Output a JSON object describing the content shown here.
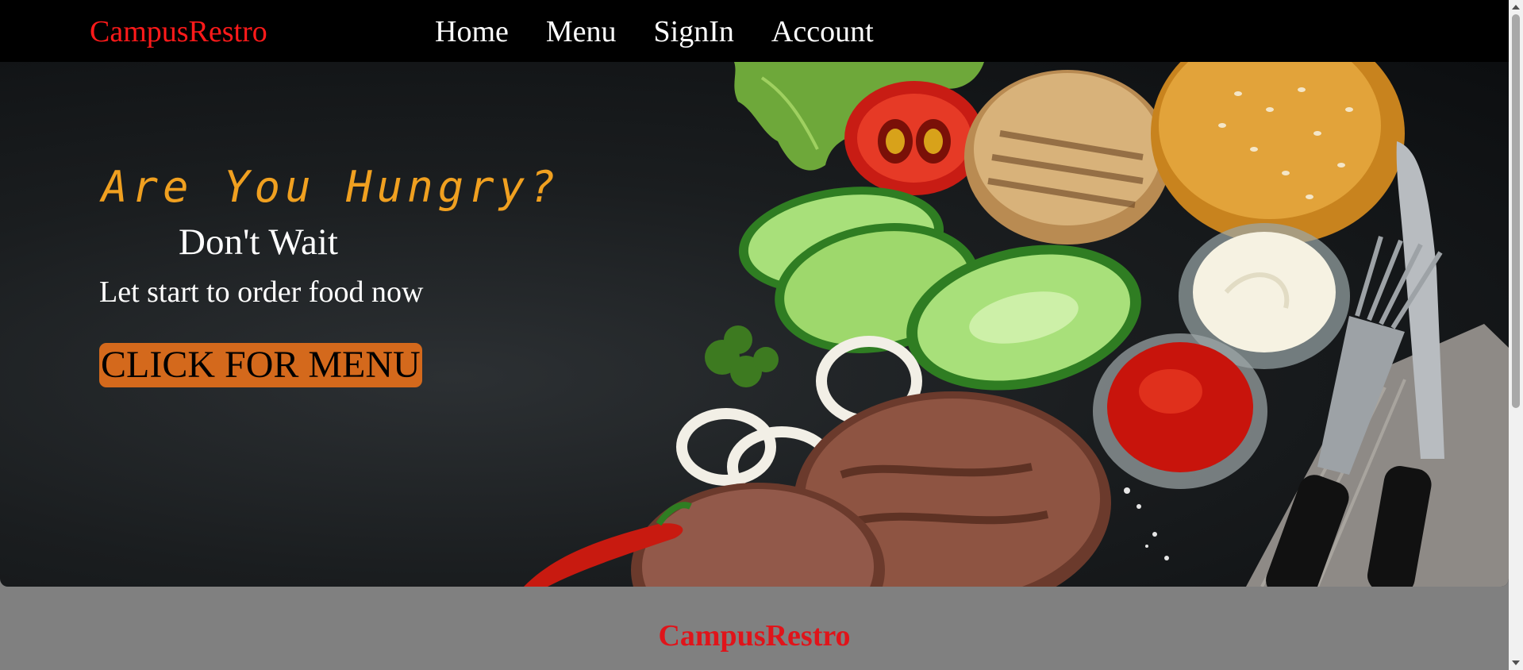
{
  "navbar": {
    "brand": "CampusRestro",
    "links": [
      "Home",
      "Menu",
      "SignIn",
      "Account"
    ]
  },
  "hero": {
    "title": "Are You Hungry?",
    "subtitle": "Don't Wait",
    "tagline": "Let start to order food now",
    "button_label": "CLICK FOR MENU",
    "image_subject": "burger ingredients: buns, patties, tomato, cucumber, onion rings, lettuce, chili pepper, mayonnaise, ketchup, fork and knife"
  },
  "footer": {
    "brand": "CampusRestro"
  },
  "colors": {
    "brand_red": "#ff1a1a",
    "title_orange": "#f0a020",
    "button_orange": "#d4691c",
    "navbar_bg": "#000000",
    "footer_bg": "#808080"
  }
}
